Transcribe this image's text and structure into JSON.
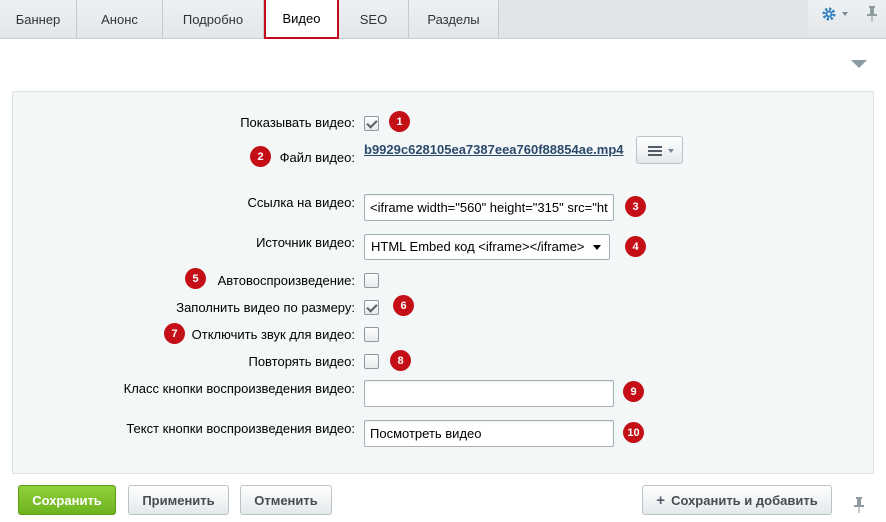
{
  "tabs": [
    {
      "label": "Баннер"
    },
    {
      "label": "Анонс"
    },
    {
      "label": "Подробно"
    },
    {
      "label": "Видео",
      "active": true
    },
    {
      "label": "SEO"
    },
    {
      "label": "Разделы"
    }
  ],
  "form": {
    "show_video": {
      "label": "Показывать видео:",
      "checked": true,
      "badge": "1"
    },
    "video_file": {
      "label": "Файл видео:",
      "value": "b9929c628105ea7387eea760f88854ae.mp4",
      "badge": "2"
    },
    "video_link": {
      "label": "Ссылка на видео:",
      "value": "<iframe width=\"560\" height=\"315\" src=\"ht",
      "badge": "3"
    },
    "video_source": {
      "label": "Источник видео:",
      "value": "HTML Embed код <iframe></iframe>",
      "badge": "4"
    },
    "autoplay": {
      "label": "Автовоспроизведение:",
      "checked": false,
      "badge": "5"
    },
    "fit_video": {
      "label": "Заполнить видео по размеру:",
      "checked": true,
      "badge": "6"
    },
    "mute": {
      "label": "Отключить звук для видео:",
      "checked": false,
      "badge": "7"
    },
    "loop": {
      "label": "Повторять видео:",
      "checked": false,
      "badge": "8"
    },
    "play_button_class": {
      "label": "Класс кнопки воспроизведения видео:",
      "value": "",
      "badge": "9"
    },
    "play_button_text": {
      "label": "Текст кнопки воспроизведения видео:",
      "value": "Посмотреть видео",
      "badge": "10"
    }
  },
  "buttons": {
    "save": "Сохранить",
    "apply": "Применить",
    "cancel": "Отменить",
    "save_add": "Сохранить и добавить"
  },
  "colors": {
    "badge": "#c40f16",
    "active_tab_border": "#c20d1e",
    "save_button": "#7cc12a"
  },
  "icons": {
    "settings": "gear-icon",
    "pin": "pin-icon",
    "collapse": "collapse-arrow-icon",
    "menu": "hamburger-menu-icon"
  }
}
